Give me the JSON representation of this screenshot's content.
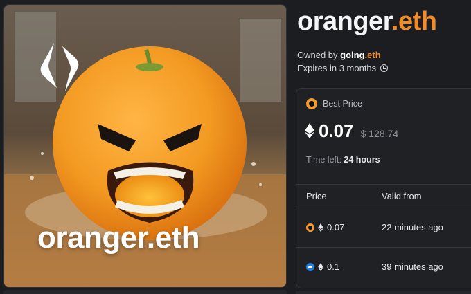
{
  "name": {
    "label": "oranger",
    "tld": ".eth"
  },
  "art": {
    "overlay_name": "oranger.eth",
    "logo_icon": "ens-logo-icon"
  },
  "owner": {
    "prefix": "Owned by ",
    "label": "going",
    "tld": ".eth"
  },
  "expiry": {
    "text": "Expires in 3 months",
    "icon": "clock-icon"
  },
  "best_price": {
    "heading": "Best Price",
    "icon": "marketplace-icon",
    "value": "0.07",
    "usd": "$ 128.74",
    "time_left_label": "Time left: ",
    "time_left_value": "24 hours"
  },
  "offers": {
    "columns": [
      "Price",
      "Valid from"
    ],
    "rows": [
      {
        "market_icon": "marketplace-icon",
        "price": "0.07",
        "valid_from": "22 minutes ago"
      },
      {
        "market_icon": "opensea-icon",
        "price": "0.1",
        "valid_from": "39 minutes ago"
      }
    ]
  },
  "colors": {
    "accent": "#f28c28",
    "background": "#1c1d21",
    "card": "#202125"
  }
}
